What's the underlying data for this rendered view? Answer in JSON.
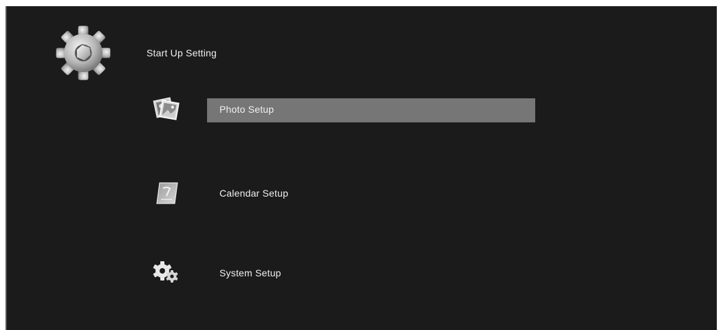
{
  "header": {
    "title": "Start Up Setting",
    "icon": "gear-icon"
  },
  "menu": {
    "items": [
      {
        "label": "Photo Setup",
        "icon": "photo-icon",
        "selected": true
      },
      {
        "label": "Calendar Setup",
        "icon": "calendar-icon",
        "selected": false
      },
      {
        "label": "System Setup",
        "icon": "system-gears-icon",
        "selected": false
      }
    ]
  },
  "colors": {
    "background": "#1b1b1b",
    "selection": "#767676",
    "text": "#f0f0f0"
  }
}
